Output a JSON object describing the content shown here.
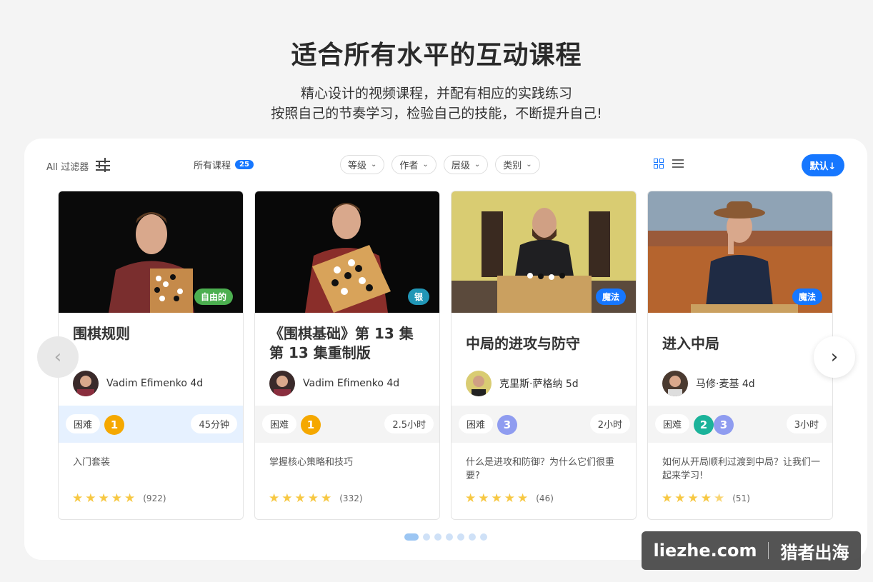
{
  "header": {
    "title": "适合所有水平的互动课程",
    "subtitle_line1": "精心设计的视频课程，并配有相应的实践练习",
    "subtitle_line2": "按照自己的节奏学习，检验自己的技能，不断提升自己!"
  },
  "toolbar": {
    "filter_label": "All 过滤器",
    "all_courses_label": "所有课程",
    "course_count": "25",
    "dropdowns": [
      "等级",
      "作者",
      "层级",
      "类别"
    ],
    "sort_label": "默认↓"
  },
  "courses": [
    {
      "tag": "自由的",
      "tag_color": "#4caf50",
      "title": "围棋规则",
      "author": "Vadim Efimenko 4d",
      "difficulty_label": "困难",
      "levels": [
        "1"
      ],
      "duration": "45分钟",
      "description": "入门套装",
      "rating_count": "(922)",
      "stars": 5
    },
    {
      "tag": "银",
      "tag_color": "#2196b6",
      "title": "《围棋基础》第 13 集 第 13 集重制版",
      "author": "Vadim Efimenko 4d",
      "difficulty_label": "困难",
      "levels": [
        "1"
      ],
      "duration": "2.5小时",
      "description": "掌握核心策略和技巧",
      "rating_count": "(332)",
      "stars": 5
    },
    {
      "tag": "魔法",
      "tag_color": "#1677ff",
      "title": "中局的进攻与防守",
      "author": "克里斯·萨格纳 5d",
      "difficulty_label": "困难",
      "levels": [
        "3"
      ],
      "duration": "2小时",
      "description": "什么是进攻和防御？为什么它们很重要?",
      "rating_count": "(46)",
      "stars": 5
    },
    {
      "tag": "魔法",
      "tag_color": "#1677ff",
      "title": "进入中局",
      "author": "马修·麦基 4d",
      "difficulty_label": "困难",
      "levels": [
        "2",
        "3"
      ],
      "duration": "3小时",
      "description": "如何从开局顺利过渡到中局？让我们一起来学习!",
      "rating_count": "(51)",
      "stars": 4.5
    }
  ],
  "level_colors": {
    "1": "#f5a800",
    "2": "#1bb39a",
    "3": "#8f9cf0"
  },
  "carousel": {
    "prev_icon": "chevron-left-icon",
    "next_icon": "chevron-right-icon",
    "page_count": 7,
    "active_page": 1
  },
  "watermark": {
    "site": "liezhe.com",
    "brand": "猎者出海"
  }
}
